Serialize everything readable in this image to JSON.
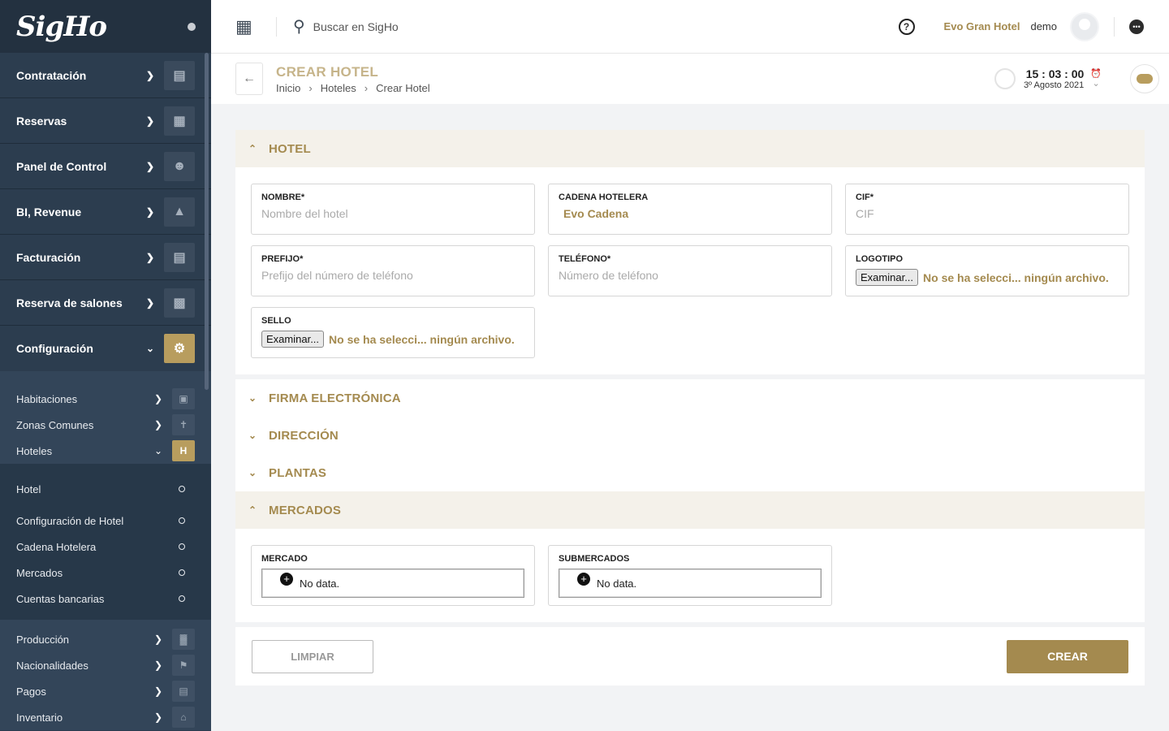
{
  "app": {
    "logo": "SigHo"
  },
  "sidebar": {
    "menu": [
      {
        "label": "Contratación",
        "icon": "contract-icon"
      },
      {
        "label": "Reservas",
        "icon": "calendar-icon"
      },
      {
        "label": "Panel de Control",
        "icon": "user-settings-icon"
      },
      {
        "label": "BI, Revenue",
        "icon": "presentation-chart-icon"
      },
      {
        "label": "Facturación",
        "icon": "invoice-icon"
      },
      {
        "label": "Reserva de salones",
        "icon": "sofa-icon"
      },
      {
        "label": "Configuración",
        "icon": "settings-icon"
      }
    ],
    "config_items": [
      {
        "label": "Habitaciones",
        "icon": "room-icon"
      },
      {
        "label": "Zonas Comunes",
        "icon": "signpost-icon"
      },
      {
        "label": "Hoteles",
        "icon": "hotel-icon",
        "icon_text": "H"
      }
    ],
    "hotel_items": [
      "Hotel",
      "Configuración de Hotel",
      "Cadena Hotelera",
      "Mercados",
      "Cuentas bancarias"
    ],
    "bottom_items": [
      {
        "label": "Producción",
        "icon": "factory-icon"
      },
      {
        "label": "Nacionalidades",
        "icon": "flag-icon"
      },
      {
        "label": "Pagos",
        "icon": "id-card-icon"
      },
      {
        "label": "Inventario",
        "icon": "warehouse-icon"
      }
    ]
  },
  "topbar": {
    "search_placeholder": "Buscar en SigHo",
    "hotel_name": "Evo Gran Hotel",
    "user_name": "demo"
  },
  "header": {
    "title": "CREAR HOTEL",
    "breadcrumb": [
      "Inicio",
      "Hoteles",
      "Crear Hotel"
    ],
    "time": "15 : 03 : 00",
    "date": "3º Agosto 2021"
  },
  "sections": {
    "hotel": "HOTEL",
    "firma": "FIRMA ELECTRÓNICA",
    "direccion": "DIRECCIÓN",
    "plantas": "PLANTAS",
    "mercados": "MERCADOS"
  },
  "form": {
    "nombre": {
      "label": "NOMBRE*",
      "placeholder": "Nombre del hotel"
    },
    "cadena": {
      "label": "CADENA HOTELERA",
      "value": "Evo Cadena"
    },
    "cif": {
      "label": "CIF*",
      "placeholder": "CIF"
    },
    "prefijo": {
      "label": "PREFIJO*",
      "placeholder": "Prefijo del número de teléfono"
    },
    "telefono": {
      "label": "TELÉFONO*",
      "placeholder": "Número de teléfono"
    },
    "logotipo": {
      "label": "LOGOTIPO",
      "button": "Examinar...",
      "status": "No se ha selecci... ningún archivo."
    },
    "sello": {
      "label": "SELLO",
      "button": "Examinar...",
      "status": "No se ha selecci... ningún archivo."
    },
    "mercado": {
      "label": "MERCADO",
      "empty": "No data."
    },
    "submercados": {
      "label": "SUBMERCADOS",
      "empty": "No data."
    }
  },
  "actions": {
    "clear": "LIMPIAR",
    "create": "CREAR"
  }
}
